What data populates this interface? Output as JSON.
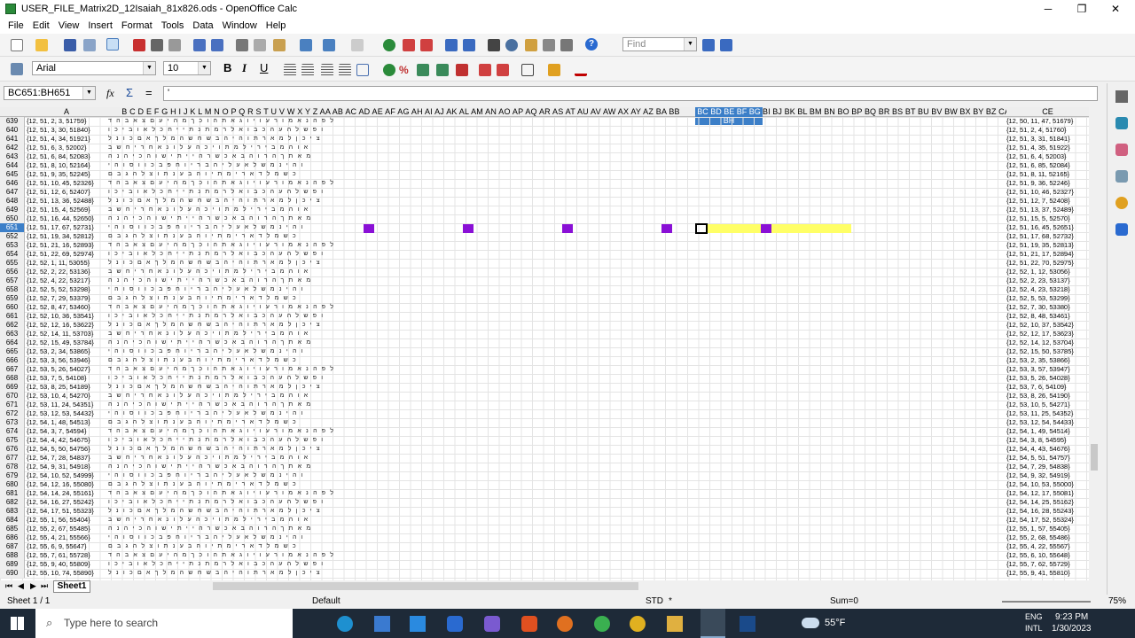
{
  "window": {
    "title": "USER_FILE_Matrix2D_12Isaiah_81x826.ods - OpenOffice Calc",
    "minimize": "─",
    "maximize": "❐",
    "close": "✕"
  },
  "menu": [
    "File",
    "Edit",
    "View",
    "Insert",
    "Format",
    "Tools",
    "Data",
    "Window",
    "Help"
  ],
  "toolbar": {
    "find_placeholder": "Find",
    "font_name": "Arial",
    "font_size": "10",
    "bold": "B",
    "italic": "I",
    "underline": "U"
  },
  "formula": {
    "name_box": "BC651:BH651",
    "fx": "fx",
    "sum": "Σ",
    "equals": "=",
    "content": "'"
  },
  "columns": {
    "a": "A",
    "letters": "B C D E F G H I J K L M N O P Q R S T U V W X Y Z AA AB AC AD AE AF AG AH AI AJ AK AL AM AN AO AP AQ AR AS AT AU AV AW AX AY AZ BA BB",
    "selected": "BC BD BE BF BG BH",
    "rest": "BI BJ BK BL BM BN BO BP BQ BR BS BT BU BV BW BX BY BZ CA CB CC CD",
    "ce": "CE"
  },
  "rows": [
    {
      "n": "639",
      "a": "{12, 51, 2, 3, 51759}",
      "ce": "{12, 50, 11, 47, 51679}"
    },
    {
      "n": "640",
      "a": "{12, 51, 3, 30, 51840}",
      "ce": "{12, 51, 2, 4, 51760}"
    },
    {
      "n": "641",
      "a": "{12, 51, 4, 34, 51921}",
      "ce": "{12, 51, 3, 31, 51841}"
    },
    {
      "n": "642",
      "a": "{12, 51, 6, 3, 52002}",
      "ce": "{12, 51, 4, 35, 51922}"
    },
    {
      "n": "643",
      "a": "{12, 51, 6, 84, 52083}",
      "ce": "{12, 51, 6, 4, 52003}"
    },
    {
      "n": "644",
      "a": "{12, 51, 8, 10, 52164}",
      "ce": "{12, 51, 6, 85, 52084}"
    },
    {
      "n": "645",
      "a": "{12, 51, 9, 35, 52245}",
      "ce": "{12, 51, 8, 11, 52165}"
    },
    {
      "n": "646",
      "a": "{12, 51, 10, 45, 52326}",
      "ce": "{12, 51, 9, 36, 52246}"
    },
    {
      "n": "647",
      "a": "{12, 51, 12, 6, 52407}",
      "ce": "{12, 51, 10, 46, 52327}"
    },
    {
      "n": "648",
      "a": "{12, 51, 13, 36, 52488}",
      "ce": "{12, 51, 12, 7, 52408}"
    },
    {
      "n": "649",
      "a": "{12, 51, 15, 4, 52569}",
      "ce": "{12, 51, 13, 37, 52489}"
    },
    {
      "n": "650",
      "a": "{12, 51, 16, 44, 52650}",
      "ce": "{12, 51, 15, 5, 52570}"
    },
    {
      "n": "651",
      "a": "{12, 51, 17, 67, 52731}",
      "ce": "{12, 51, 16, 45, 52651}"
    },
    {
      "n": "652",
      "a": "{12, 51, 19, 34, 52812}",
      "ce": "{12, 51, 17, 68, 52732}"
    },
    {
      "n": "653",
      "a": "{12, 51, 21, 16, 52893}",
      "ce": "{12, 51, 19, 35, 52813}"
    },
    {
      "n": "654",
      "a": "{12, 51, 22, 69, 52974}",
      "ce": "{12, 51, 21, 17, 52894}"
    },
    {
      "n": "655",
      "a": "{12, 52, 1, 11, 53055}",
      "ce": "{12, 51, 22, 70, 52975}"
    },
    {
      "n": "656",
      "a": "{12, 52, 2, 22, 53136}",
      "ce": "{12, 52, 1, 12, 53056}"
    },
    {
      "n": "657",
      "a": "{12, 52, 4, 22, 53217}",
      "ce": "{12, 52, 2, 23, 53137}"
    },
    {
      "n": "658",
      "a": "{12, 52, 5, 52, 53298}",
      "ce": "{12, 52, 4, 23, 53218}"
    },
    {
      "n": "659",
      "a": "{12, 52, 7, 29, 53379}",
      "ce": "{12, 52, 5, 53, 53299}"
    },
    {
      "n": "660",
      "a": "{12, 52, 8, 47, 53460}",
      "ce": "{12, 52, 7, 30, 53380}"
    },
    {
      "n": "661",
      "a": "{12, 52, 10, 36, 53541}",
      "ce": "{12, 52, 8, 48, 53461}"
    },
    {
      "n": "662",
      "a": "{12, 52, 12, 16, 53622}",
      "ce": "{12, 52, 10, 37, 53542}"
    },
    {
      "n": "663",
      "a": "{12, 52, 14, 11, 53703}",
      "ce": "{12, 52, 12, 17, 53623}"
    },
    {
      "n": "664",
      "a": "{12, 52, 15, 49, 53784}",
      "ce": "{12, 52, 14, 12, 53704}"
    },
    {
      "n": "665",
      "a": "{12, 53, 2, 34, 53865}",
      "ce": "{12, 52, 15, 50, 53785}"
    },
    {
      "n": "666",
      "a": "{12, 53, 3, 56, 53946}",
      "ce": "{12, 53, 2, 35, 53866}"
    },
    {
      "n": "667",
      "a": "{12, 53, 5, 26, 54027}",
      "ce": "{12, 53, 3, 57, 53947}"
    },
    {
      "n": "668",
      "a": "{12, 53, 7, 5, 54108}",
      "ce": "{12, 53, 5, 26, 54028}"
    },
    {
      "n": "669",
      "a": "{12, 53, 8, 25, 54189}",
      "ce": "{12, 53, 7, 6, 54109}"
    },
    {
      "n": "670",
      "a": "{12, 53, 10, 4, 54270}",
      "ce": "{12, 53, 8, 26, 54190}"
    },
    {
      "n": "671",
      "a": "{12, 53, 11, 24, 54351}",
      "ce": "{12, 53, 10, 5, 54271}"
    },
    {
      "n": "672",
      "a": "{12, 53, 12, 53, 54432}",
      "ce": "{12, 53, 11, 25, 54352}"
    },
    {
      "n": "673",
      "a": "{12, 54, 1, 48, 54513}",
      "ce": "{12, 53, 12, 54, 54433}"
    },
    {
      "n": "674",
      "a": "{12, 54, 3, 7, 54594}",
      "ce": "{12, 54, 1, 49, 54514}"
    },
    {
      "n": "675",
      "a": "{12, 54, 4, 42, 54675}",
      "ce": "{12, 54, 3, 8, 54595}"
    },
    {
      "n": "676",
      "a": "{12, 54, 5, 50, 54756}",
      "ce": "{12, 54, 4, 43, 54676}"
    },
    {
      "n": "677",
      "a": "{12, 54, 7, 28, 54837}",
      "ce": "{12, 54, 5, 51, 54757}"
    },
    {
      "n": "678",
      "a": "{12, 54, 9, 31, 54918}",
      "ce": "{12, 54, 7, 29, 54838}"
    },
    {
      "n": "679",
      "a": "{12, 54, 10, 52, 54999}",
      "ce": "{12, 54, 9, 32, 54919}"
    },
    {
      "n": "680",
      "a": "{12, 54, 12, 16, 55080}",
      "ce": "{12, 54, 10, 53, 55000}"
    },
    {
      "n": "681",
      "a": "{12, 54, 14, 24, 55161}",
      "ce": "{12, 54, 12, 17, 55081}"
    },
    {
      "n": "682",
      "a": "{12, 54, 16, 27, 55242}",
      "ce": "{12, 54, 14, 25, 55162}"
    },
    {
      "n": "683",
      "a": "{12, 54, 17, 51, 55323}",
      "ce": "{12, 54, 16, 28, 55243}"
    },
    {
      "n": "684",
      "a": "{12, 55, 1, 56, 55404}",
      "ce": "{12, 54, 17, 52, 55324}"
    },
    {
      "n": "685",
      "a": "{12, 55, 2, 67, 55485}",
      "ce": "{12, 55, 1, 57, 55405}"
    },
    {
      "n": "686",
      "a": "{12, 55, 4, 21, 55566}",
      "ce": "{12, 55, 2, 68, 55486}"
    },
    {
      "n": "687",
      "a": "{12, 55, 6, 9, 55647}",
      "ce": "{12, 55, 4, 22, 55567}"
    },
    {
      "n": "688",
      "a": "{12, 55, 7, 61, 55728}",
      "ce": "{12, 55, 6, 10, 55648}"
    },
    {
      "n": "689",
      "a": "{12, 55, 9, 40, 55809}",
      "ce": "{12, 55, 7, 62, 55729}"
    },
    {
      "n": "690",
      "a": "{12, 55, 10, 74, 55890}",
      "ce": "{12, 55, 9, 41, 55810}"
    }
  ],
  "hebrew_cells": [
    "לפהנאמורעויוגאתהוכךמהיעםצאבהד",
    "ופשלהעהכבואלרמתנתייחכלאוביכו",
    "ציכןלמארתוהיהבשחשהמלךאםכונל",
    "אוהמבירילמתויכהעלונאחריחשב",
    "מאתךהרוהבאכשרהייתישוהכיהנה",
    "והינמשלאעליהבריוחפבכווסוהי",
    "כשמלדארימתיוהבענתוצלהגבם"
  ],
  "sheetbar": {
    "tab": "Sheet1"
  },
  "status": {
    "sheet": "Sheet 1 / 1",
    "style": "Default",
    "mode": "STD",
    "modified": "*",
    "sum": "Sum=0",
    "zoom": "75%"
  },
  "taskbar": {
    "search": "Type here to search",
    "weather": "55°F",
    "lang1": "ENG",
    "lang2": "INTL",
    "time": "9:23 PM",
    "date": "1/30/2023"
  },
  "colors": {
    "purple": "#8a10d6",
    "yellow": "#ffff66",
    "selection": "#3c7fc8"
  }
}
